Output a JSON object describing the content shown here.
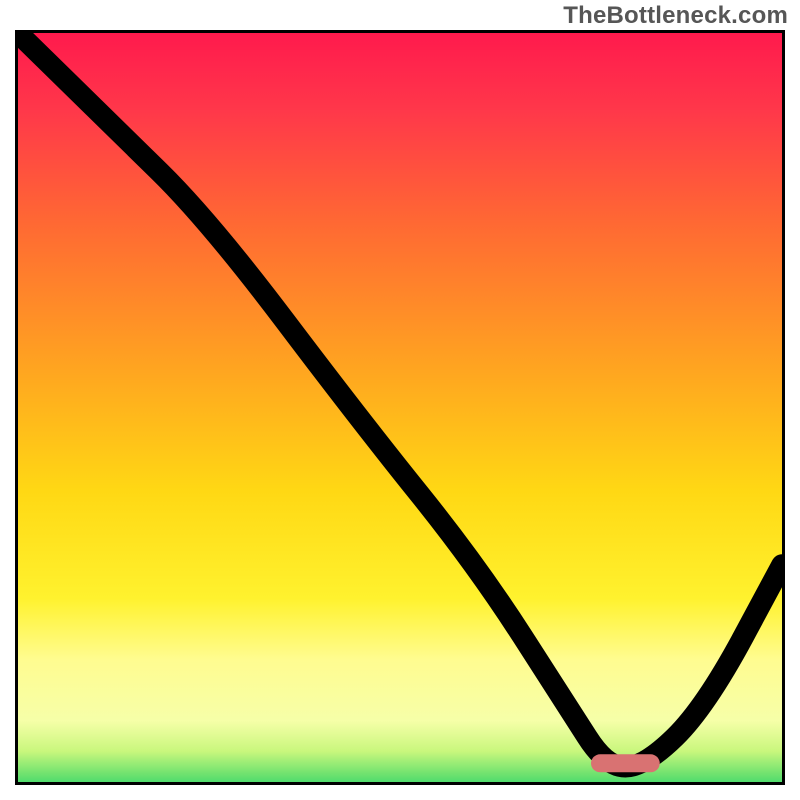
{
  "watermark": "TheBottleneck.com",
  "chart_data": {
    "type": "line",
    "title": "",
    "xlabel": "",
    "ylabel": "",
    "xlim": [
      0,
      100
    ],
    "ylim": [
      0,
      100
    ],
    "grid": false,
    "legend": false,
    "background": {
      "description": "Vertical gradient: red (top) through orange, yellow, pale-yellow to green (bottom)",
      "stops": [
        {
          "pct": 0,
          "color": "#ff1a4d"
        },
        {
          "pct": 10,
          "color": "#ff374a"
        },
        {
          "pct": 25,
          "color": "#ff6933"
        },
        {
          "pct": 45,
          "color": "#ffa81f"
        },
        {
          "pct": 60,
          "color": "#ffd814"
        },
        {
          "pct": 74,
          "color": "#fff22e"
        },
        {
          "pct": 82,
          "color": "#fffc90"
        },
        {
          "pct": 90,
          "color": "#f6ffa8"
        },
        {
          "pct": 94,
          "color": "#c9f77d"
        },
        {
          "pct": 97,
          "color": "#6fe26f"
        },
        {
          "pct": 100,
          "color": "#18d06a"
        }
      ]
    },
    "series": [
      {
        "name": "bottleneck-curve",
        "x": [
          0,
          12,
          25,
          45,
          60,
          72,
          77,
          82,
          90,
          100
        ],
        "y": [
          100,
          88,
          75,
          48,
          29,
          10,
          2,
          2,
          10,
          29
        ]
      }
    ],
    "marker": {
      "name": "optimal-range",
      "shape": "rounded-rect",
      "color": "#d97272",
      "x_range": [
        75,
        84
      ],
      "y": 2.5,
      "height": 2.4
    }
  }
}
